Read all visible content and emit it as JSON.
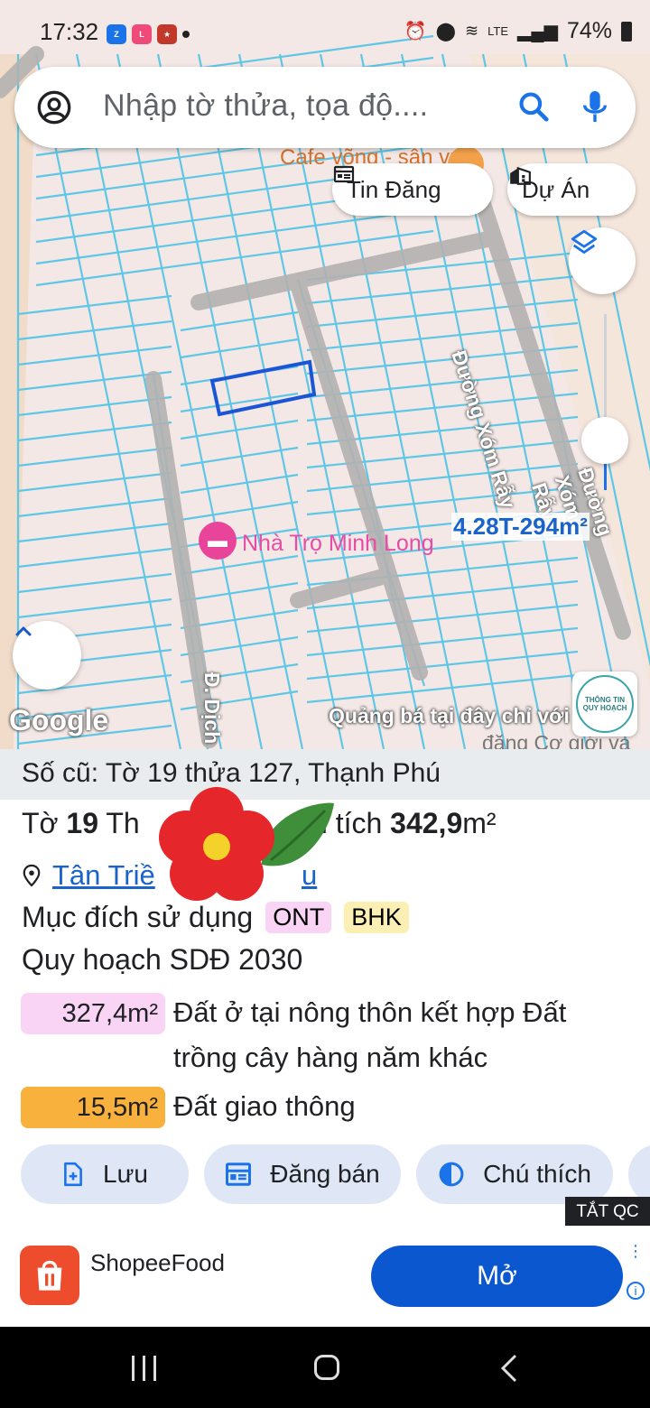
{
  "status_bar": {
    "time": "17:32",
    "app_icons": [
      "zalo-icon",
      "lazada-icon",
      "game-icon"
    ],
    "battery": "74%",
    "network": "LTE"
  },
  "search": {
    "placeholder": "Nhập tờ thửa, tọa độ...."
  },
  "chips": {
    "tin_dang": "Tin Đăng",
    "du_an": "Dự Án"
  },
  "map": {
    "poi_cafe": "Cafe võng - sân vườ",
    "poi_nha_tro": "Nhà Trọ Minh Long",
    "road_1": "Đường Xóm Rẫy",
    "road_2": "Đường Xóm Rẫy",
    "road_3": "Đ. Dịch",
    "parcel_label": "4.28T-294m²",
    "promo": "Quảng bá tại đây chỉ với",
    "promo_2": "đăng Cơ giới và",
    "google": "Google",
    "info_badge_1": "THÔNG TIN",
    "info_badge_2": "QUY HOẠCH"
  },
  "sheet": {
    "old_line": "Số cũ: Tờ 19 thửa 127, Thạnh Phú",
    "to_prefix": "Tờ ",
    "to_num": "19",
    "to_mid": " Th",
    "area_label": "n tích ",
    "area_value": "342,9",
    "area_unit": "m²",
    "location": "Tân Triề",
    "location_tail": "u",
    "purpose_label": "Mục đích sử dụng",
    "tags": [
      "ONT",
      "BHK"
    ],
    "plan_title": "Quy hoạch SDĐ 2030",
    "plan_items": [
      {
        "area": "327,4m²",
        "desc_1": "Đất ở tại nông thôn kết hợp Đất",
        "desc_2": "trồng cây hàng năm khác",
        "color": "#f9d4f4"
      },
      {
        "area": "15,5m²",
        "desc_1": "Đất giao thông",
        "color": "#f9b13e"
      }
    ],
    "actions": {
      "save": "Lưu",
      "post": "Đăng bán",
      "legend": "Chú thích"
    }
  },
  "ad": {
    "close_ads": "TẮT QC",
    "app_name": "ShopeeFood",
    "open": "Mở"
  },
  "colors": {
    "accent": "#1a73e8",
    "open_button": "#0b57d0",
    "grid": "#5fc7e6"
  }
}
